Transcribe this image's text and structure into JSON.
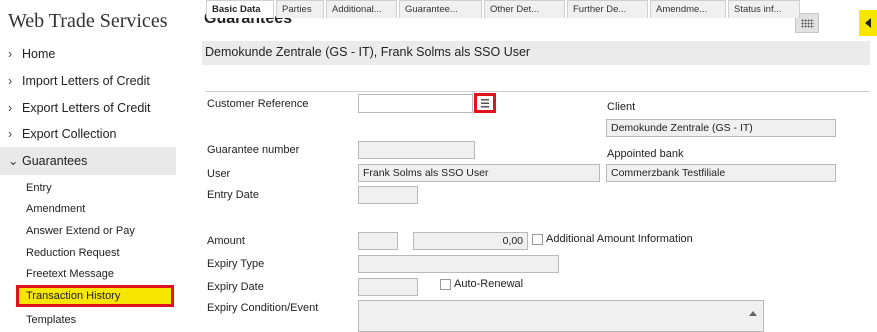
{
  "app": {
    "title": "Web Trade Services"
  },
  "sidebar": {
    "items": [
      {
        "label": "Home",
        "chevron": "›"
      },
      {
        "label": "Import Letters of Credit",
        "chevron": "›"
      },
      {
        "label": "Export Letters of Credit",
        "chevron": "›"
      },
      {
        "label": "Export Collection",
        "chevron": "›"
      },
      {
        "label": "Guarantees",
        "chevron": "⌄"
      }
    ],
    "subitems": [
      {
        "label": "Entry"
      },
      {
        "label": "Amendment"
      },
      {
        "label": "Answer Extend or Pay"
      },
      {
        "label": "Reduction Request"
      },
      {
        "label": "Freetext Message"
      },
      {
        "label": "Transaction History"
      },
      {
        "label": "Templates"
      }
    ]
  },
  "header": {
    "title": "Guarantees",
    "grid_icon": "grid-icon",
    "collapse_icon": "triangle-left-icon"
  },
  "customer": {
    "label": "Demokunde Zentrale (GS - IT), Frank Solms als SSO User"
  },
  "tabs": [
    {
      "label": "Basic Data"
    },
    {
      "label": "Parties"
    },
    {
      "label": "Additional..."
    },
    {
      "label": "Guarantee..."
    },
    {
      "label": "Other Det..."
    },
    {
      "label": "Further De..."
    },
    {
      "label": "Amendme..."
    },
    {
      "label": "Status inf..."
    }
  ],
  "form": {
    "customer_reference": {
      "label": "Customer Reference",
      "value": ""
    },
    "client": {
      "label": "Client",
      "value": "Demokunde Zentrale (GS - IT)"
    },
    "guarantee_number": {
      "label": "Guarantee number",
      "value": ""
    },
    "appointed_bank": {
      "label": "Appointed bank",
      "value": "Commerzbank Testfiliale"
    },
    "user": {
      "label": "User",
      "value": "Frank Solms als SSO User"
    },
    "entry_date": {
      "label": "Entry Date",
      "value": ""
    },
    "amount": {
      "label": "Amount",
      "currency": "",
      "value": "0,00"
    },
    "additional_amount": {
      "label": "Additional Amount Information"
    },
    "expiry_type": {
      "label": "Expiry Type",
      "value": ""
    },
    "expiry_date": {
      "label": "Expiry Date",
      "value": ""
    },
    "auto_renewal": {
      "label": "Auto-Renewal"
    },
    "expiry_condition": {
      "label": "Expiry Condition/Event",
      "value": ""
    }
  },
  "colors": {
    "highlight": "#f6e600",
    "outline": "#e0141e",
    "field_bg": "#f0f0f0"
  }
}
